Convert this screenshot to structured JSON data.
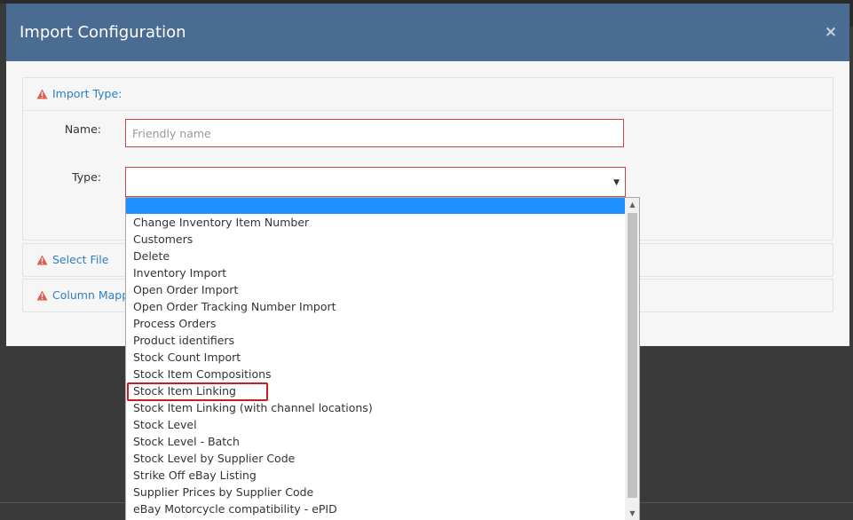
{
  "modal": {
    "title": "Import Configuration",
    "close_icon": "×"
  },
  "panels": {
    "import_type": {
      "heading": "Import Type:"
    },
    "select_file": {
      "heading": "Select File"
    },
    "column_mapping": {
      "heading": "Column Mapp"
    }
  },
  "form": {
    "name_label": "Name:",
    "name_placeholder": "Friendly name",
    "name_value": "",
    "type_label": "Type:",
    "type_value": ""
  },
  "dropdown": {
    "items": [
      "",
      "Change Inventory Item Number",
      "Customers",
      "Delete",
      "Inventory Import",
      "Open Order Import",
      "Open Order Tracking Number Import",
      "Process Orders",
      "Product identifiers",
      "Stock Count Import",
      "Stock Item Compositions",
      "Stock Item Linking",
      "Stock Item Linking (with channel locations)",
      "Stock Level",
      "Stock Level - Batch",
      "Stock Level by Supplier Code",
      "Strike Off eBay Listing",
      "Supplier Prices by Supplier Code",
      "eBay Motorcycle compatibility - ePID"
    ],
    "selected_index": 0,
    "outlined_index": 11
  },
  "colors": {
    "header_bg": "#4a6b92",
    "link": "#2d7fc1",
    "warning": "#e05c4b",
    "error_border": "#cc4444",
    "selected_bg": "#1e90ff",
    "outline": "#cc1c1c"
  },
  "icons": {
    "warning": "warning-triangle-icon",
    "close": "close-icon",
    "select_arrow": "caret-down-icon"
  }
}
